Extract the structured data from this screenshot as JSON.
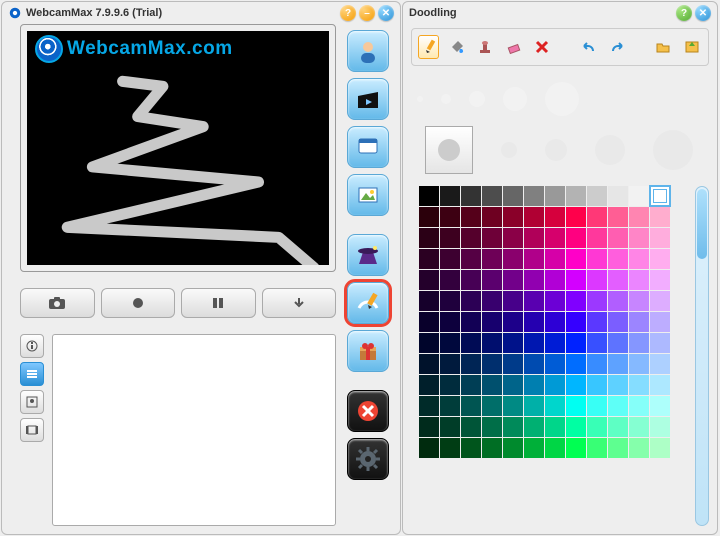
{
  "left": {
    "title": "WebcamMax  7.9.9.6  (Trial)",
    "watermark_text": "WebcamMax.com",
    "controls": [
      "camera",
      "record",
      "pause",
      "download"
    ],
    "info_tabs": [
      "info",
      "list",
      "contact",
      "film"
    ],
    "active_info_tab": 1,
    "side_buttons": [
      {
        "name": "source-person",
        "glyph": "person"
      },
      {
        "name": "source-movie",
        "glyph": "clap"
      },
      {
        "name": "source-desktop",
        "glyph": "window"
      },
      {
        "name": "source-image",
        "glyph": "pic"
      },
      {
        "name": "effects-wizard",
        "glyph": "wizard"
      },
      {
        "name": "doodling",
        "glyph": "pencil",
        "selected": true
      },
      {
        "name": "gifts",
        "glyph": "gift"
      },
      {
        "name": "close-effects",
        "glyph": "x",
        "dark": true
      },
      {
        "name": "settings",
        "glyph": "gear",
        "dark": true
      }
    ]
  },
  "right": {
    "title": "Doodling",
    "tools": [
      {
        "name": "pencil-tool",
        "active": true
      },
      {
        "name": "fill-tool"
      },
      {
        "name": "stamp-tool"
      },
      {
        "name": "eraser-tool"
      },
      {
        "name": "clear-tool"
      },
      {
        "name": "sep"
      },
      {
        "name": "undo-tool"
      },
      {
        "name": "redo-tool"
      },
      {
        "name": "sep"
      },
      {
        "name": "open-tool"
      },
      {
        "name": "save-tool"
      }
    ],
    "palette_selected_index": 11,
    "palette": [
      "#000000",
      "#1a1a1a",
      "#333333",
      "#4d4d4d",
      "#666666",
      "#808080",
      "#999999",
      "#b3b3b3",
      "#cccccc",
      "#e6e6e6",
      "#f2f2f2",
      "#ffffff",
      "#2b000b",
      "#3d0012",
      "#55001a",
      "#6e0021",
      "#8a0029",
      "#b00033",
      "#d6003d",
      "#ff004b",
      "#ff3877",
      "#ff5e94",
      "#ff85b1",
      "#ffadce",
      "#2b0016",
      "#3d001f",
      "#55002c",
      "#6e0038",
      "#8a0047",
      "#b00059",
      "#d6006c",
      "#ff0080",
      "#ff389c",
      "#ff5eb1",
      "#ff85c7",
      "#ffaddd",
      "#2b0022",
      "#3d0030",
      "#550044",
      "#6e0057",
      "#8a006d",
      "#b0008a",
      "#d600a8",
      "#ff00c8",
      "#ff38d4",
      "#ff5edd",
      "#ff85e6",
      "#ffadef",
      "#24002b",
      "#33003d",
      "#470055",
      "#5b006e",
      "#72008a",
      "#9100b0",
      "#b100d6",
      "#d300ff",
      "#dc38ff",
      "#e35eff",
      "#eb85ff",
      "#f2adff",
      "#16002b",
      "#1f003d",
      "#2c0055",
      "#38006e",
      "#47008a",
      "#5900b0",
      "#6c00d6",
      "#8000ff",
      "#9c38ff",
      "#b15eff",
      "#c785ff",
      "#ddadff",
      "#09002b",
      "#0d003d",
      "#120055",
      "#17006e",
      "#1d008a",
      "#2500b0",
      "#2d00d6",
      "#3500ff",
      "#5b38ff",
      "#7b5eff",
      "#9c85ff",
      "#bdadff",
      "#00052b",
      "#00083d",
      "#000b55",
      "#000e6e",
      "#00128a",
      "#0017b0",
      "#001cd6",
      "#0022ff",
      "#3850ff",
      "#5e73ff",
      "#8596ff",
      "#adb9ff",
      "#00122b",
      "#001a3d",
      "#002555",
      "#002f6e",
      "#003b8a",
      "#004bb0",
      "#005cd6",
      "#006dff",
      "#388cff",
      "#5ea2ff",
      "#85b9ff",
      "#add0ff",
      "#001f2b",
      "#002c3d",
      "#003e55",
      "#00506e",
      "#00648a",
      "#007fb0",
      "#009ad6",
      "#00b6ff",
      "#38c6ff",
      "#5ed1ff",
      "#85ddff",
      "#ade8ff",
      "#002b29",
      "#003d3a",
      "#005552",
      "#006e69",
      "#008a84",
      "#00b0a8",
      "#00d6cc",
      "#00fff2",
      "#38fff5",
      "#5efff7",
      "#85fff9",
      "#adfffb",
      "#002b1c",
      "#003d28",
      "#005538",
      "#006e48",
      "#008a5a",
      "#00b072",
      "#00d68a",
      "#00ffa3",
      "#38ffb6",
      "#5effc4",
      "#85ffd2",
      "#adffe1",
      "#002b0e",
      "#003d14",
      "#00551c",
      "#006e24",
      "#008a2d",
      "#00b039",
      "#00d645",
      "#00ff52",
      "#38ff75",
      "#5eff90",
      "#85ffab",
      "#adffc6"
    ]
  }
}
